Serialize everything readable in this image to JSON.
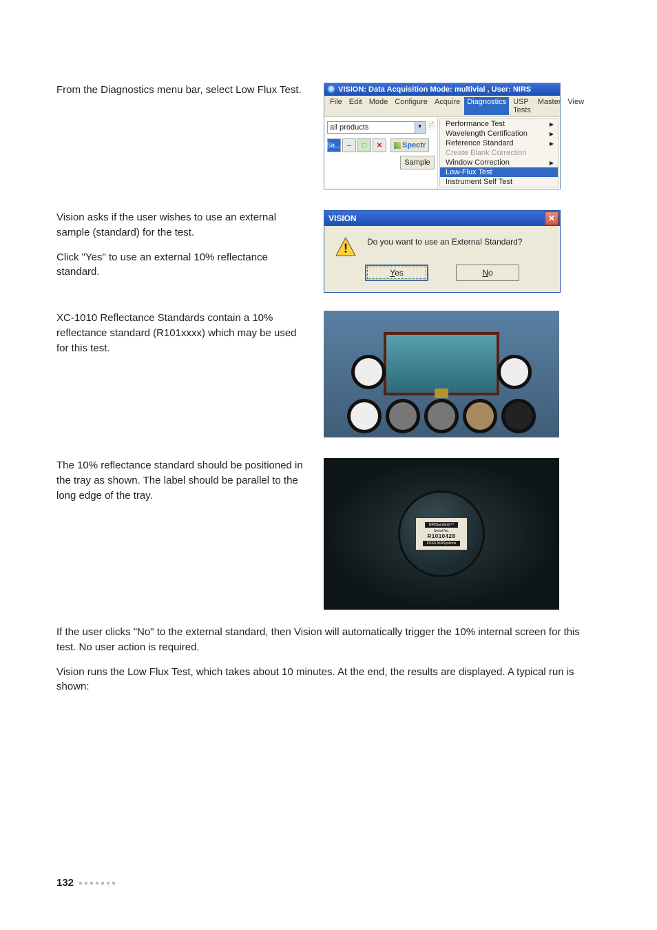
{
  "paragraphs": {
    "p1": "From the Diagnostics menu bar, select Low Flux Test.",
    "p2": "Vision asks if the user wishes to use an external sample (standard) for the test.",
    "p3": "Click \"Yes\" to use an external 10% reflectance standard.",
    "p4": "XC-1010 Reflectance Standards contain a 10% reflectance standard (R101xxxx) which may be used for this test.",
    "p5": "The 10% reflectance standard should be positioned in the tray as shown. The label should be parallel to the long edge of the tray.",
    "p6": "If the user clicks \"No\" to the external standard, then Vision will automatically trigger the 10% internal screen for this test. No user action is required.",
    "p7": "Vision runs the Low Flux Test, which takes about 10 minutes. At the end, the results are displayed. A typical run is shown:"
  },
  "vision_window": {
    "title": "VISION: Data Acquisition Mode: multivial , User: NIRS",
    "menubar": [
      "File",
      "Edit",
      "Mode",
      "Configure",
      "Acquire",
      "Diagnostics",
      "USP Tests",
      "Master",
      "View"
    ],
    "combo_value": "all products",
    "spectr_label": "Spectr",
    "sample_button": "Sample",
    "diagnostics_menu": [
      {
        "label": "Performance Test",
        "arrow": true,
        "disabled": false
      },
      {
        "label": "Wavelength Certification",
        "arrow": true,
        "disabled": false
      },
      {
        "label": "Reference Standard",
        "arrow": true,
        "disabled": false
      },
      {
        "label": "Create Blank Correction",
        "arrow": false,
        "disabled": true
      },
      {
        "label": "Window Correction",
        "arrow": true,
        "disabled": false
      },
      {
        "label": "Low-Flux Test",
        "arrow": false,
        "disabled": false,
        "highlight": true
      },
      {
        "label": "Instrument Self Test",
        "arrow": false,
        "disabled": false
      }
    ]
  },
  "dialog": {
    "title": "VISION",
    "message": "Do you want to use an External Standard?",
    "yes_prefix": "Y",
    "yes_rest": "es",
    "no_prefix": "N",
    "no_rest": "o"
  },
  "tray_label": {
    "brand": "NIRStandards™",
    "serial_caption": "Serial No.",
    "serial": "R1010428",
    "footer": "FOSS NIRSystems"
  },
  "toolbar_chips": {
    "sa": "Sa…",
    "minus": "–",
    "square": "□",
    "close": "✕"
  },
  "icon_glyphs": {
    "new_doc": "🗎"
  },
  "page_number": "132"
}
